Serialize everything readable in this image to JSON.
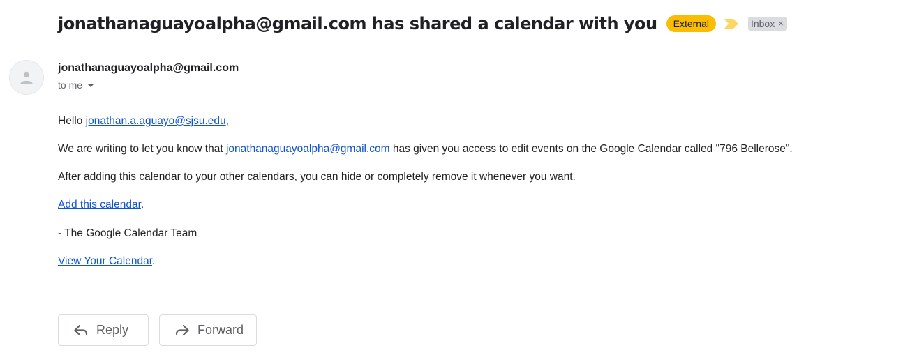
{
  "email": {
    "subject": "jonathanaguayoalpha@gmail.com has shared a calendar with you",
    "external_badge": "External",
    "label": "Inbox",
    "label_remove": "×",
    "sender": "jonathanaguayoalpha@gmail.com",
    "recipients": "to me",
    "body": {
      "greeting_prefix": "Hello ",
      "greeting_link": "jonathan.a.aguayo@sjsu.edu",
      "greeting_suffix": ",",
      "p1_prefix": "We are writing to let you know that ",
      "p1_link": "jonathanaguayoalpha@gmail.com",
      "p1_suffix": " has given you access to edit events on the Google Calendar called \"796 Bellerose\".",
      "p2": "After adding this calendar to your other calendars, you can hide or completely remove it whenever you want.",
      "add_link": "Add this calendar",
      "add_suffix": ".",
      "signature": "- The Google Calendar Team",
      "view_link": "View Your Calendar",
      "view_suffix": "."
    }
  },
  "actions": {
    "reply": "Reply",
    "forward": "Forward"
  },
  "colors": {
    "external_badge": "#fbbc04",
    "importance_marker": "#fdd663",
    "link": "#1155cc"
  }
}
